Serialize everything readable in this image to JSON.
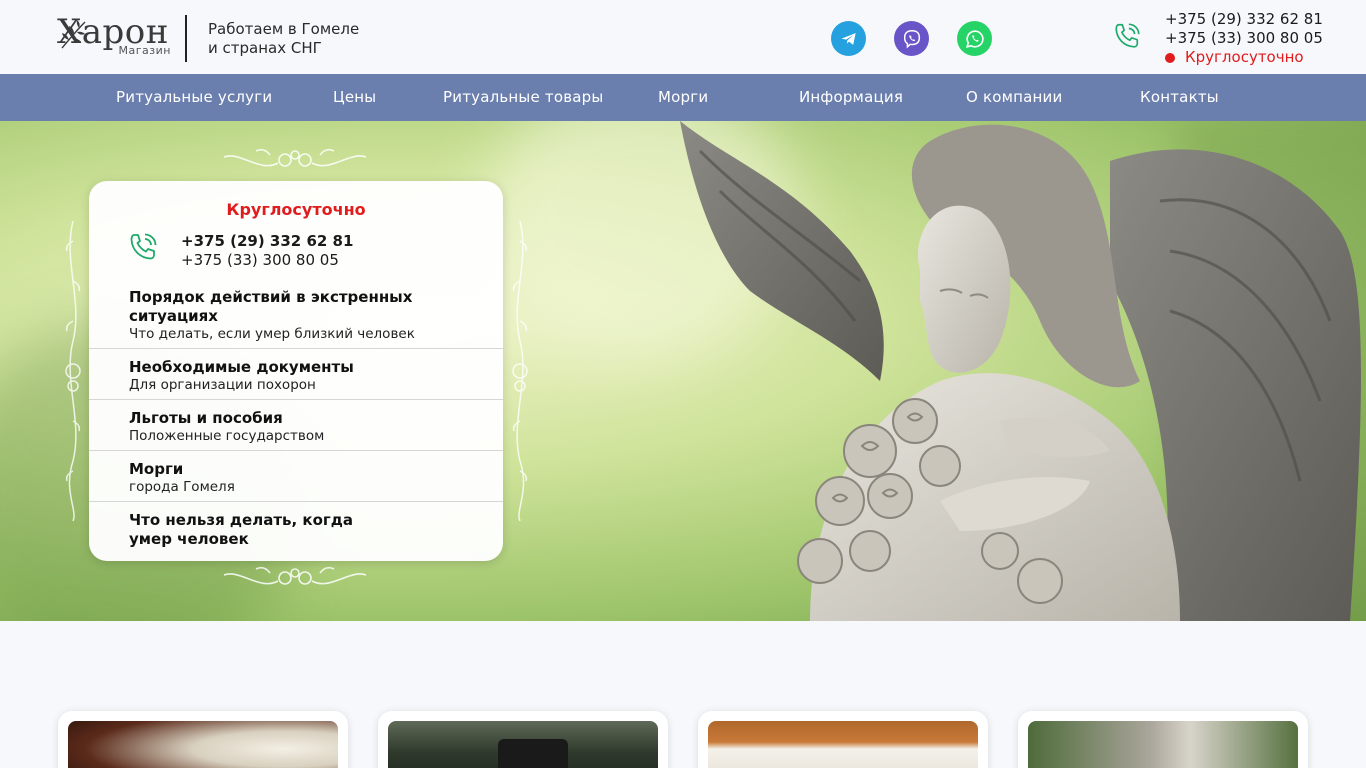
{
  "header": {
    "logo_text": "Харон",
    "logo_sub": "Магазин",
    "tagline_line1": "Работаем в Гомеле",
    "tagline_line2": "и странах СНГ",
    "phone1": "+375 (29) 332 62 81",
    "phone2": "+375 (33) 300 80 05",
    "availability": "Круглосуточно",
    "social": [
      "telegram-icon",
      "viber-icon",
      "whatsapp-icon"
    ]
  },
  "nav": {
    "items": [
      "Ритуальные услуги",
      "Цены",
      "Ритуальные товары",
      "Морги",
      "Информация",
      "О компании",
      "Контакты"
    ]
  },
  "hero_card": {
    "availability": "Круглосуточно",
    "phone1": "+375 (29) 332 62 81",
    "phone2": "+375 (33) 300 80 05",
    "items": [
      {
        "title_line1": "Порядок действий в экстренных",
        "title_line2": "ситуациях",
        "subtitle": "Что делать, если умер близкий человек"
      },
      {
        "title_line1": "Необходимые документы",
        "title_line2": "",
        "subtitle": "Для организации похорон"
      },
      {
        "title_line1": "Льготы и пособия",
        "title_line2": "",
        "subtitle": "Положенные государством"
      },
      {
        "title_line1": "Морги",
        "title_line2": "",
        "subtitle": "города Гомеля"
      },
      {
        "title_line1": "Что нельзя делать, когда",
        "title_line2": "умер человек",
        "subtitle": ""
      }
    ]
  },
  "colors": {
    "nav_bg": "#6b7fae",
    "accent_red": "#e01c1c",
    "phone_icon_green": "#1fa96b",
    "telegram": "#24a1de",
    "viber": "#6a55c8",
    "whatsapp": "#25d366"
  }
}
